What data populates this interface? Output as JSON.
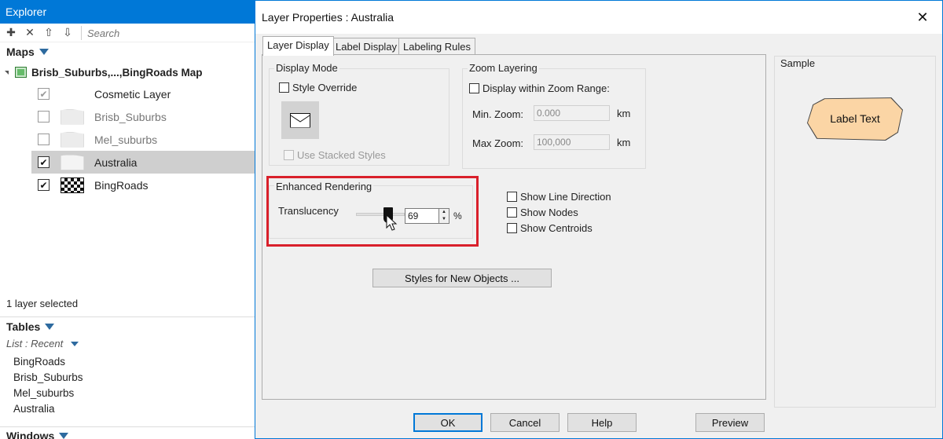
{
  "explorer": {
    "title": "Explorer",
    "search_placeholder": "Search",
    "maps_header": "Maps",
    "map_name": "Brisb_Suburbs,...,BingRoads Map",
    "layers": [
      {
        "name": "Cosmetic Layer",
        "checked": true,
        "dimmed": true
      },
      {
        "name": "Brisb_Suburbs",
        "checked": false,
        "dimmed": true
      },
      {
        "name": "Mel_suburbs",
        "checked": false,
        "dimmed": true
      },
      {
        "name": "Australia",
        "checked": true,
        "dimmed": false,
        "selected": true
      },
      {
        "name": "BingRoads",
        "checked": true,
        "dimmed": false
      }
    ],
    "status": "1 layer selected",
    "table_header": "Tables",
    "list_recent": "List : Recent",
    "tables": [
      "BingRoads",
      "Brisb_Suburbs",
      "Mel_suburbs",
      "Australia"
    ],
    "windows_header": "Windows"
  },
  "dialog": {
    "title": "Layer Properties  : Australia",
    "close_glyph": "✕",
    "tabs": [
      "Layer Display",
      "Label Display",
      "Labeling Rules"
    ],
    "display_mode": {
      "title": "Display Mode",
      "style_override": "Style Override",
      "use_stacked_styles": "Use Stacked Styles"
    },
    "zoom_layering": {
      "title": "Zoom Layering",
      "display_within": "Display within Zoom Range:",
      "min_label": "Min. Zoom:",
      "min_value": "0.000",
      "max_label": "Max Zoom:",
      "max_value": "100,000",
      "unit": "km"
    },
    "enhanced_rendering": {
      "title": "Enhanced Rendering",
      "translucency_label": "Translucency",
      "translucency_value": "69",
      "percent": "%"
    },
    "options": [
      "Show Line Direction",
      "Show Nodes",
      "Show Centroids"
    ],
    "styles_button": "Styles for New Objects ...",
    "sample": {
      "title": "Sample",
      "label_text": "Label Text"
    },
    "buttons": {
      "ok": "OK",
      "cancel": "Cancel",
      "help": "Help",
      "preview": "Preview"
    }
  },
  "colors": {
    "accent": "#0078d7",
    "highlight": "#d9202b",
    "label_fill": "#fbd5a5",
    "selection": "#cfcfcf"
  }
}
